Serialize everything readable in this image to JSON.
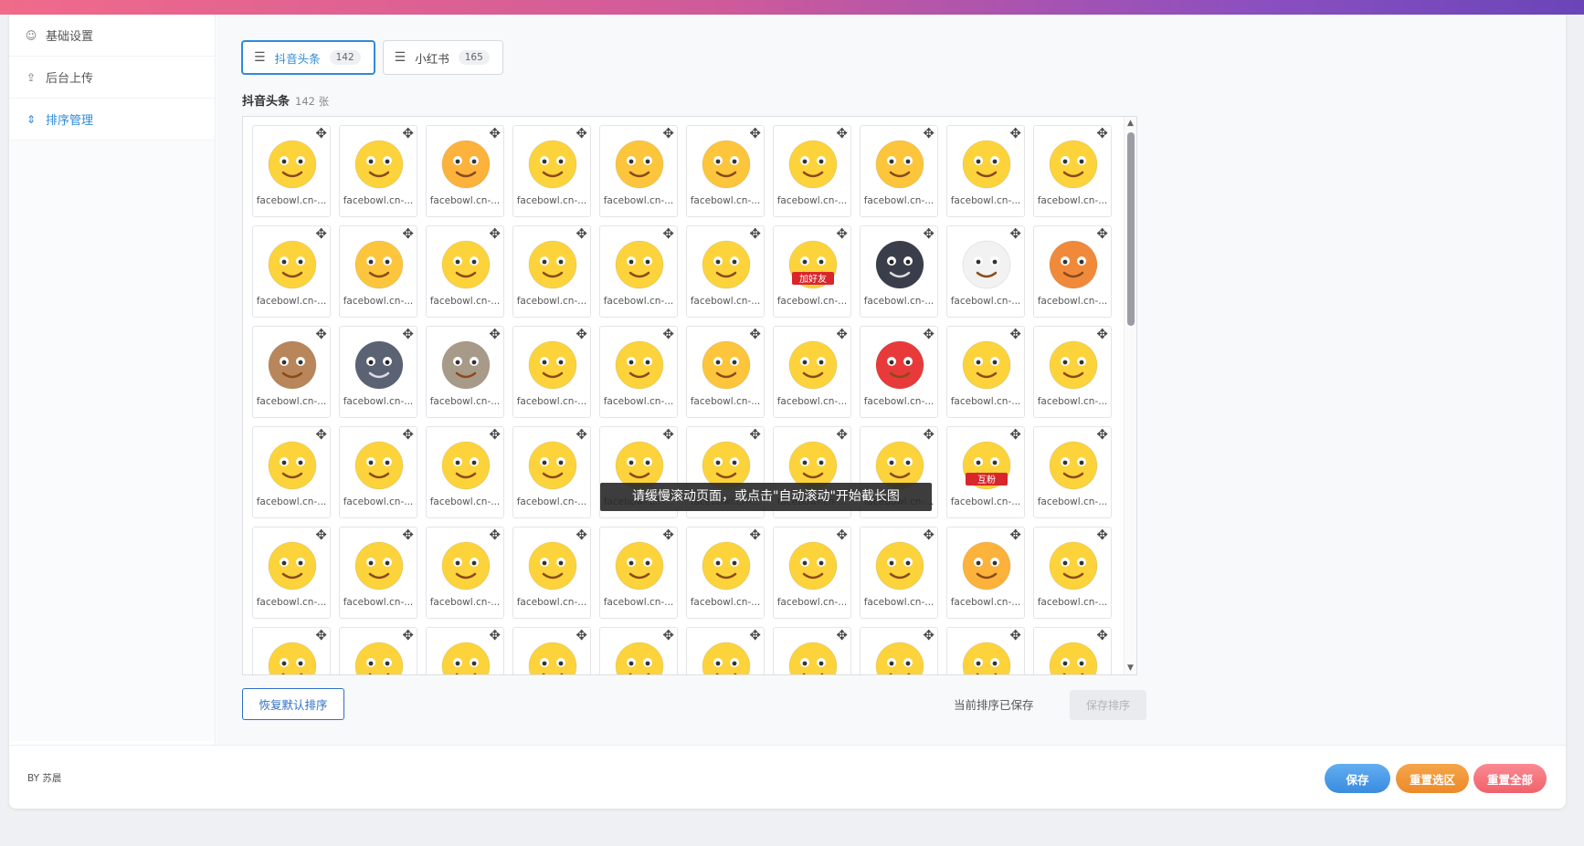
{
  "sidebar": {
    "items": [
      {
        "label": "基础设置",
        "icon": "smile-icon"
      },
      {
        "label": "后台上传",
        "icon": "upload-icon"
      },
      {
        "label": "排序管理",
        "icon": "sort-icon",
        "active": true
      }
    ]
  },
  "tabs": [
    {
      "label": "抖音头条",
      "count": "142",
      "active": true
    },
    {
      "label": "小红书",
      "count": "165",
      "active": false
    }
  ],
  "section": {
    "title": "抖音头条",
    "count": "142 张"
  },
  "emojis": [
    {
      "name": "facebowl.cn-...",
      "bg": "#fcd33b",
      "label": ""
    },
    {
      "name": "facebowl.cn-...",
      "bg": "#fcd33b",
      "label": ""
    },
    {
      "name": "facebowl.cn-...",
      "bg": "#fcb23b",
      "label": ""
    },
    {
      "name": "facebowl.cn-...",
      "bg": "#fcd33b",
      "label": ""
    },
    {
      "name": "facebowl.cn-...",
      "bg": "#fcc53b",
      "label": ""
    },
    {
      "name": "facebowl.cn-...",
      "bg": "#fcc53b",
      "label": ""
    },
    {
      "name": "facebowl.cn-...",
      "bg": "#fcd33b",
      "label": ""
    },
    {
      "name": "facebowl.cn-...",
      "bg": "#fcc53b",
      "label": ""
    },
    {
      "name": "facebowl.cn-...",
      "bg": "#fcd33b",
      "label": ""
    },
    {
      "name": "facebowl.cn-...",
      "bg": "#fcd33b",
      "label": ""
    },
    {
      "name": "facebowl.cn-...",
      "bg": "#fcd33b",
      "label": ""
    },
    {
      "name": "facebowl.cn-...",
      "bg": "#fcc53b",
      "label": ""
    },
    {
      "name": "facebowl.cn-...",
      "bg": "#fcd33b",
      "label": ""
    },
    {
      "name": "facebowl.cn-...",
      "bg": "#fcd33b",
      "label": ""
    },
    {
      "name": "facebowl.cn-...",
      "bg": "#fcd33b",
      "label": ""
    },
    {
      "name": "facebowl.cn-...",
      "bg": "#fcd33b",
      "label": ""
    },
    {
      "name": "facebowl.cn-...",
      "bg": "#fcd33b",
      "label": "加好友"
    },
    {
      "name": "facebowl.cn-...",
      "bg": "#3a3e4a",
      "label": ""
    },
    {
      "name": "facebowl.cn-...",
      "bg": "#f2f2f2",
      "label": ""
    },
    {
      "name": "facebowl.cn-...",
      "bg": "#f08a3a",
      "label": ""
    },
    {
      "name": "facebowl.cn-...",
      "bg": "#b8865a",
      "label": ""
    },
    {
      "name": "facebowl.cn-...",
      "bg": "#5a6274",
      "label": ""
    },
    {
      "name": "facebowl.cn-...",
      "bg": "#a89a88",
      "label": ""
    },
    {
      "name": "facebowl.cn-...",
      "bg": "#fcd33b",
      "label": ""
    },
    {
      "name": "facebowl.cn-...",
      "bg": "#fcd33b",
      "label": ""
    },
    {
      "name": "facebowl.cn-...",
      "bg": "#fcc53b",
      "label": ""
    },
    {
      "name": "facebowl.cn-...",
      "bg": "#fcd33b",
      "label": ""
    },
    {
      "name": "facebowl.cn-...",
      "bg": "#e83a3a",
      "label": ""
    },
    {
      "name": "facebowl.cn-...",
      "bg": "#fcd33b",
      "label": ""
    },
    {
      "name": "facebowl.cn-...",
      "bg": "#fcd33b",
      "label": ""
    },
    {
      "name": "facebowl.cn-...",
      "bg": "#fcd33b",
      "label": ""
    },
    {
      "name": "facebowl.cn-...",
      "bg": "#fcd33b",
      "label": ""
    },
    {
      "name": "facebowl.cn-...",
      "bg": "#fcd33b",
      "label": ""
    },
    {
      "name": "facebowl.cn-...",
      "bg": "#fcd33b",
      "label": ""
    },
    {
      "name": "facebowl.cn-...",
      "bg": "#fcd33b",
      "label": ""
    },
    {
      "name": "facebowl.cn-...",
      "bg": "#fcd33b",
      "label": ""
    },
    {
      "name": "facebowl.cn-...",
      "bg": "#fcd33b",
      "label": ""
    },
    {
      "name": "facebowl.cn-...",
      "bg": "#fcd33b",
      "label": ""
    },
    {
      "name": "facebowl.cn-...",
      "bg": "#fcd33b",
      "label": "互粉"
    },
    {
      "name": "facebowl.cn-...",
      "bg": "#fcd33b",
      "label": ""
    },
    {
      "name": "facebowl.cn-...",
      "bg": "#fcd33b",
      "label": ""
    },
    {
      "name": "facebowl.cn-...",
      "bg": "#fcd33b",
      "label": ""
    },
    {
      "name": "facebowl.cn-...",
      "bg": "#fcd33b",
      "label": ""
    },
    {
      "name": "facebowl.cn-...",
      "bg": "#fcd33b",
      "label": ""
    },
    {
      "name": "facebowl.cn-...",
      "bg": "#fcd33b",
      "label": ""
    },
    {
      "name": "facebowl.cn-...",
      "bg": "#fcd33b",
      "label": ""
    },
    {
      "name": "facebowl.cn-...",
      "bg": "#fcd33b",
      "label": ""
    },
    {
      "name": "facebowl.cn-...",
      "bg": "#fcd33b",
      "label": ""
    },
    {
      "name": "facebowl.cn-...",
      "bg": "#fcb23b",
      "label": ""
    },
    {
      "name": "facebowl.cn-...",
      "bg": "#fcd33b",
      "label": ""
    },
    {
      "name": "",
      "bg": "#fcd33b",
      "label": ""
    },
    {
      "name": "",
      "bg": "#fcd33b",
      "label": ""
    },
    {
      "name": "",
      "bg": "#fcd33b",
      "label": ""
    },
    {
      "name": "",
      "bg": "#fcd33b",
      "label": ""
    },
    {
      "name": "",
      "bg": "#fcd33b",
      "label": ""
    },
    {
      "name": "",
      "bg": "#fcd33b",
      "label": ""
    },
    {
      "name": "",
      "bg": "#fcd33b",
      "label": ""
    },
    {
      "name": "",
      "bg": "#fcd33b",
      "label": ""
    },
    {
      "name": "",
      "bg": "#fcd33b",
      "label": ""
    },
    {
      "name": "",
      "bg": "#fcd33b",
      "label": ""
    }
  ],
  "toast": "请缓慢滚动页面，或点击\"自动滚动\"开始截长图",
  "footer_actions": {
    "reset_default": "恢复默认排序",
    "saved_status": "当前排序已保存",
    "save_sort": "保存排序"
  },
  "footer": {
    "credit": "BY 苏晨",
    "save": "保存",
    "reset_selection": "重置选区",
    "reset_all": "重置全部"
  },
  "colors": {
    "accent": "#2f8bd8",
    "emoji_yellow": "#fcd33b"
  }
}
